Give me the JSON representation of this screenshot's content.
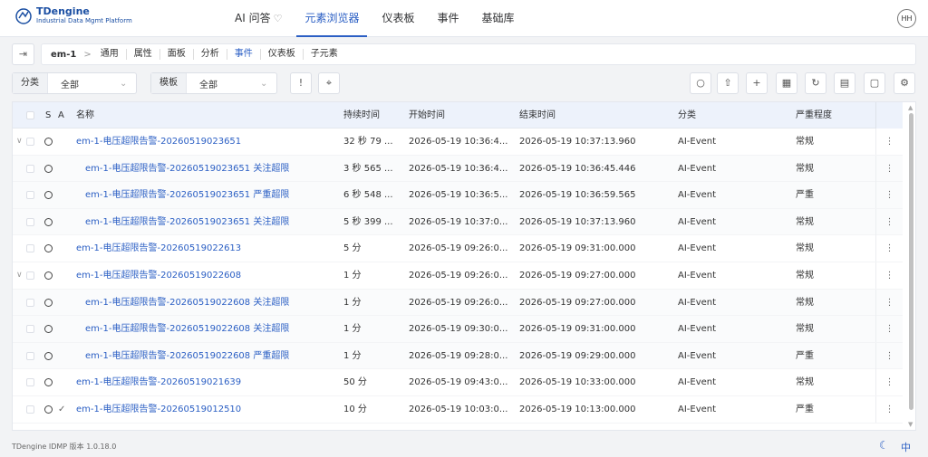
{
  "header": {
    "brand": "TDengine",
    "brand_sub": "Industrial Data Mgmt Platform",
    "nav": [
      {
        "label": "AI 问答",
        "icon": "sparkle-icon"
      },
      {
        "label": "元素浏览器",
        "active": true
      },
      {
        "label": "仪表板"
      },
      {
        "label": "事件"
      },
      {
        "label": "基础库"
      }
    ],
    "avatar": "HH"
  },
  "breadcrumb": {
    "root": "em-1",
    "sep": ">",
    "tabs": [
      "通用",
      "属性",
      "面板",
      "分析",
      "事件",
      "仪表板",
      "子元素"
    ],
    "active": "事件"
  },
  "toolbar": {
    "category": {
      "label": "分类",
      "value": "全部"
    },
    "template": {
      "label": "模板",
      "value": "全部"
    },
    "alert_btn": "!",
    "locate_icon": "target-icon",
    "actions": [
      "search-icon",
      "export-icon",
      "add-icon",
      "table-icon",
      "refresh-icon",
      "report-icon",
      "document-icon",
      "settings-icon"
    ]
  },
  "table": {
    "columns": {
      "s": "S",
      "a": "A",
      "name": "名称",
      "duration": "持续时间",
      "start": "开始时间",
      "end": "结束时间",
      "category": "分类",
      "severity": "严重程度"
    },
    "rows": [
      {
        "caret": "∨",
        "name": "em-1-电压超限告警-20260519023651",
        "duration": "32 秒 79 ...",
        "start": "2026-05-19 10:36:4...",
        "end": "2026-05-19 10:37:13.960",
        "category": "AI-Event",
        "severity": "常规"
      },
      {
        "sub": true,
        "name": "em-1-电压超限告警-20260519023651 关注超限",
        "duration": "3 秒 565 ...",
        "start": "2026-05-19 10:36:4...",
        "end": "2026-05-19 10:36:45.446",
        "category": "AI-Event",
        "severity": "常规"
      },
      {
        "sub": true,
        "name": "em-1-电压超限告警-20260519023651 严重超限",
        "duration": "6 秒 548 ...",
        "start": "2026-05-19 10:36:5...",
        "end": "2026-05-19 10:36:59.565",
        "category": "AI-Event",
        "severity": "严重"
      },
      {
        "sub": true,
        "name": "em-1-电压超限告警-20260519023651 关注超限",
        "duration": "5 秒 399 ...",
        "start": "2026-05-19 10:37:0...",
        "end": "2026-05-19 10:37:13.960",
        "category": "AI-Event",
        "severity": "常规"
      },
      {
        "name": "em-1-电压超限告警-20260519022613",
        "duration": "5 分",
        "start": "2026-05-19 09:26:0...",
        "end": "2026-05-19 09:31:00.000",
        "category": "AI-Event",
        "severity": "常规"
      },
      {
        "caret": "∨",
        "name": "em-1-电压超限告警-20260519022608",
        "duration": "1 分",
        "start": "2026-05-19 09:26:0...",
        "end": "2026-05-19 09:27:00.000",
        "category": "AI-Event",
        "severity": "常规"
      },
      {
        "sub": true,
        "name": "em-1-电压超限告警-20260519022608 关注超限",
        "duration": "1 分",
        "start": "2026-05-19 09:26:0...",
        "end": "2026-05-19 09:27:00.000",
        "category": "AI-Event",
        "severity": "常规"
      },
      {
        "sub": true,
        "name": "em-1-电压超限告警-20260519022608 关注超限",
        "duration": "1 分",
        "start": "2026-05-19 09:30:0...",
        "end": "2026-05-19 09:31:00.000",
        "category": "AI-Event",
        "severity": "常规"
      },
      {
        "sub": true,
        "name": "em-1-电压超限告警-20260519022608 严重超限",
        "duration": "1 分",
        "start": "2026-05-19 09:28:0...",
        "end": "2026-05-19 09:29:00.000",
        "category": "AI-Event",
        "severity": "严重"
      },
      {
        "name": "em-1-电压超限告警-20260519021639",
        "duration": "50 分",
        "start": "2026-05-19 09:43:0...",
        "end": "2026-05-19 10:33:00.000",
        "category": "AI-Event",
        "severity": "常规"
      },
      {
        "ack": "✓",
        "name": "em-1-电压超限告警-20260519012510",
        "duration": "10 分",
        "start": "2026-05-19 10:03:0...",
        "end": "2026-05-19 10:13:00.000",
        "category": "AI-Event",
        "severity": "严重"
      }
    ],
    "row_menu": "⋮"
  },
  "footer": {
    "version": "TDengine IDMP 版本 1.0.18.0",
    "theme_icon": "moon-icon",
    "lang": "中"
  },
  "colors": {
    "accent": "#2b5fc4",
    "header_bg": "#edf2fb"
  }
}
